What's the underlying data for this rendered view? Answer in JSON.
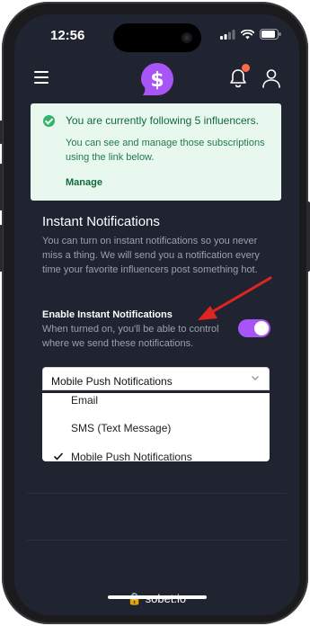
{
  "status_bar": {
    "time": "12:56"
  },
  "alert": {
    "title": "You are currently following 5 influencers.",
    "message": "You can see and manage those subscriptions using the link below.",
    "link": "Manage"
  },
  "instant": {
    "title": "Instant Notifications",
    "description": "You can turn on instant notifications so you never miss a thing. We will send you a notification every time your favorite influencers post something hot."
  },
  "toggle": {
    "label": "Enable Instant Notifications",
    "description": "When turned on, you'll be able to control where we send these notifications.",
    "enabled": true
  },
  "select": {
    "value": "Mobile Push Notifications",
    "options": [
      "Email",
      "SMS (Text Message)",
      "Mobile Push Notifications"
    ],
    "selected_index": 2
  },
  "browser": {
    "url": "sobet.io"
  },
  "colors": {
    "accent": "#a855f7",
    "success_bg": "#e8f8ef",
    "background": "#1f2430",
    "annotation_arrow": "#e02424"
  }
}
